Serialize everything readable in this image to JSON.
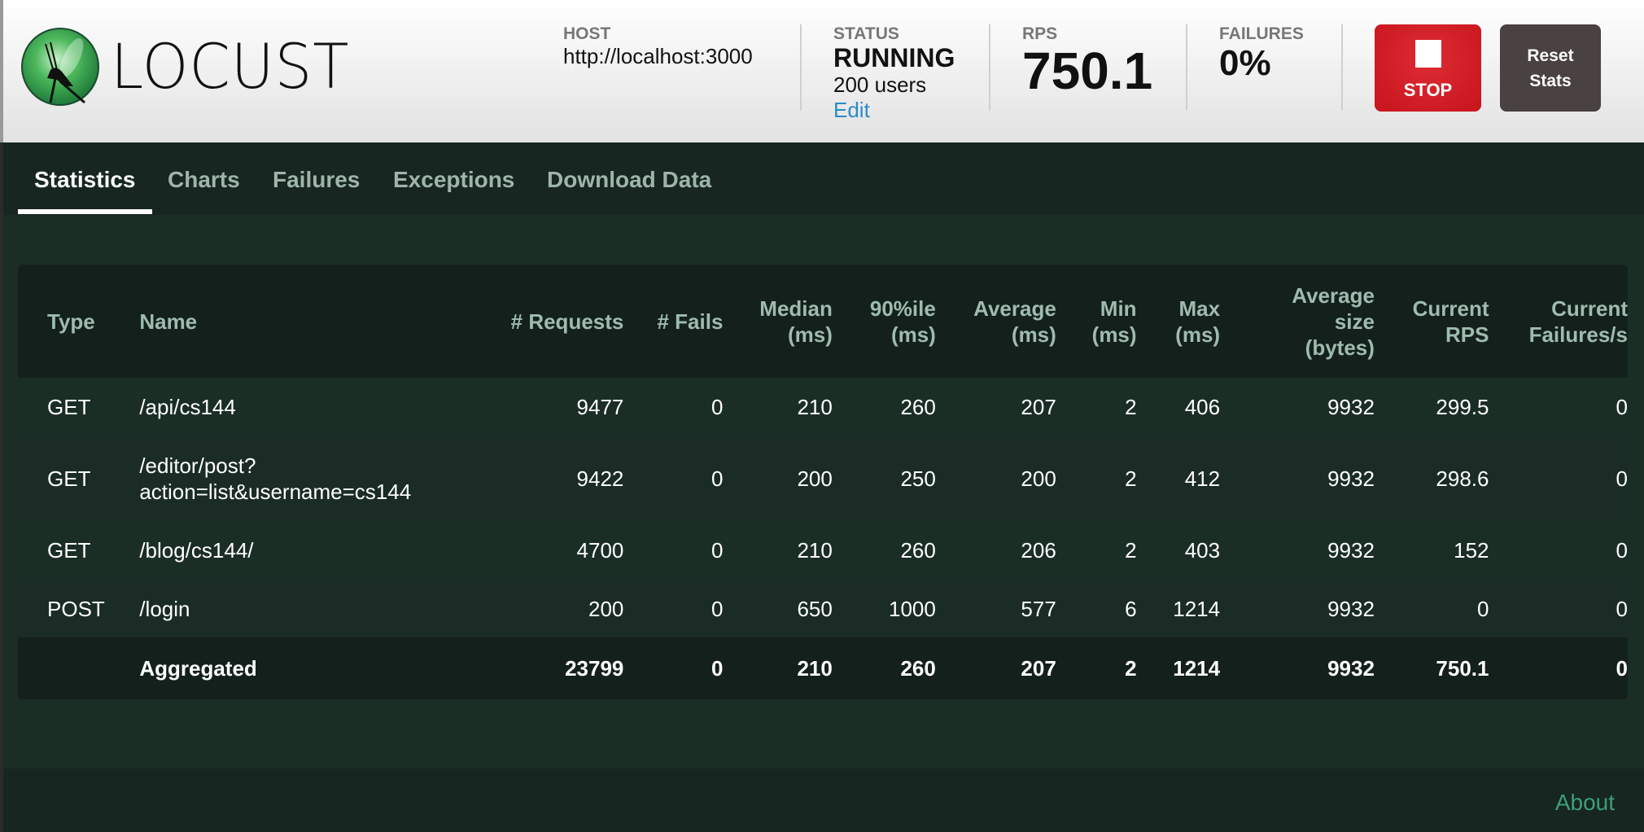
{
  "header": {
    "brand": "LOCUST",
    "host": {
      "label": "HOST",
      "value": "http://localhost:3000"
    },
    "status": {
      "label": "STATUS",
      "value": "RUNNING",
      "users": "200 users",
      "edit": "Edit"
    },
    "rps": {
      "label": "RPS",
      "value": "750.1"
    },
    "failures": {
      "label": "FAILURES",
      "value": "0%"
    },
    "stop_label": "STOP",
    "reset_label_1": "Reset",
    "reset_label_2": "Stats"
  },
  "tabs": [
    {
      "label": "Statistics",
      "active": true
    },
    {
      "label": "Charts"
    },
    {
      "label": "Failures"
    },
    {
      "label": "Exceptions"
    },
    {
      "label": "Download Data"
    }
  ],
  "table": {
    "headers": [
      "Type",
      "Name",
      "# Requests",
      "# Fails",
      "Median (ms)",
      "90%ile (ms)",
      "Average (ms)",
      "Min (ms)",
      "Max (ms)",
      "Average size (bytes)",
      "Current RPS",
      "Current Failures/s"
    ],
    "rows": [
      [
        "GET",
        "/api/cs144",
        "9477",
        "0",
        "210",
        "260",
        "207",
        "2",
        "406",
        "9932",
        "299.5",
        "0"
      ],
      [
        "GET",
        "/editor/post?action=list&username=cs144",
        "9422",
        "0",
        "200",
        "250",
        "200",
        "2",
        "412",
        "9932",
        "298.6",
        "0"
      ],
      [
        "GET",
        "/blog/cs144/",
        "4700",
        "0",
        "210",
        "260",
        "206",
        "2",
        "403",
        "9932",
        "152",
        "0"
      ],
      [
        "POST",
        "/login",
        "200",
        "0",
        "650",
        "1000",
        "577",
        "6",
        "1214",
        "9932",
        "0",
        "0"
      ]
    ],
    "aggregated": [
      "",
      "Aggregated",
      "23799",
      "0",
      "210",
      "260",
      "207",
      "2",
      "1214",
      "9932",
      "750.1",
      "0"
    ]
  },
  "footer": {
    "about": "About"
  },
  "colors": {
    "stop": "#d01c24",
    "reset": "#4a4141",
    "background": "#1a2e26",
    "link": "#2a8ac8",
    "about": "#3e9e78"
  }
}
